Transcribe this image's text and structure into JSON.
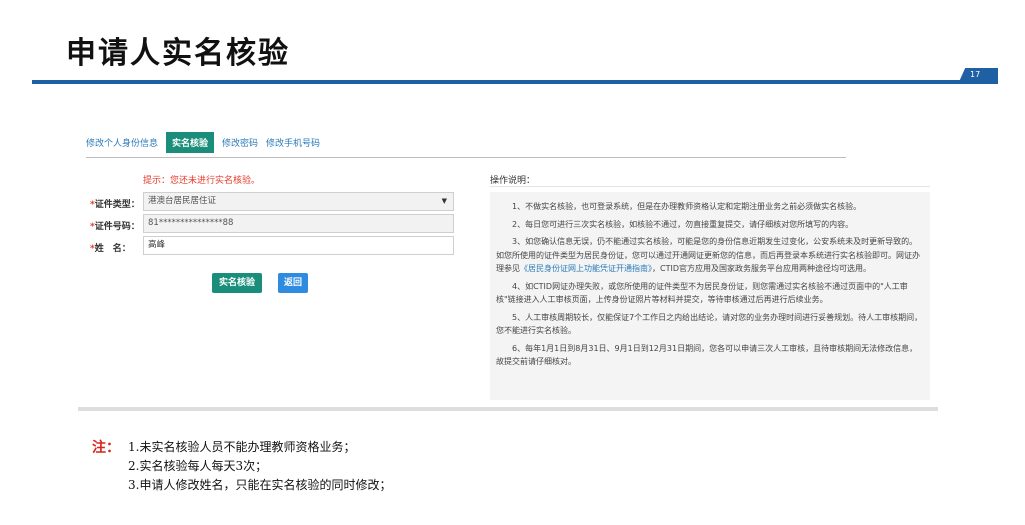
{
  "slide": {
    "title": "申请人实名核验",
    "page_number": "17"
  },
  "tabs": [
    {
      "label": "修改个人身份信息",
      "active": false
    },
    {
      "label": "实名核验",
      "active": true
    },
    {
      "label": "修改密码",
      "active": false
    },
    {
      "label": "修改手机号码",
      "active": false
    }
  ],
  "hint": "提示：您还未进行实名核验。",
  "form": {
    "id_type": {
      "label": "证件类型：",
      "value": "港澳台居民居住证"
    },
    "id_number": {
      "label": "证件号码：",
      "value": "81***************88"
    },
    "name": {
      "label": "姓　名：",
      "value": "高峰"
    },
    "verify_button": "实名核验",
    "back_button": "返回"
  },
  "instructions": {
    "title": "操作说明：",
    "p1": "1、不做实名核验，也可登录系统，但是在办理教师资格认定和定期注册业务之前必须做实名核验。",
    "p2": "2、每日您可进行三次实名核验，如核验不通过，勿直接重复提交，请仔细核对您所填写的内容。",
    "p3a": "3、如您确认信息无误，仍不能通过实名核验，可能是您的身份信息近期发生过变化，公安系统未及时更新导致的。如您所使用的证件类型为居民身份证，您可以通过开通网证更新您的信息，而后再登录本系统进行实名核验即可。网证办理参见",
    "p3_link": "《居民身份证网上功能凭证开通指南》",
    "p3b": "，CTID官方应用及国家政务服务平台应用两种途径均可选用。",
    "p4": "4、如CTID网证办理失败，或您所使用的证件类型不为居民身份证，则您需通过实名核验不通过页面中的\"人工审核\"链接进入人工审核页面，上传身份证照片等材料并提交，等待审核通过后再进行后续业务。",
    "p5": "5、人工审核周期较长，仅能保证7个工作日之内给出结论，请对您的业务办理时间进行妥善规划。待人工审核期间，您不能进行实名核验。",
    "p6": "6、每年1月1日到8月31日、9月1日到12月31日期间，您各可以申请三次人工审核，且待审核期间无法修改信息，故提交前请仔细核对。"
  },
  "notes": {
    "label": "注：",
    "items": [
      "1.未实名核验人员不能办理教师资格业务；",
      "2.实名核验每人每天3次；",
      "3.申请人修改姓名，只能在实名核验的同时修改；"
    ]
  }
}
